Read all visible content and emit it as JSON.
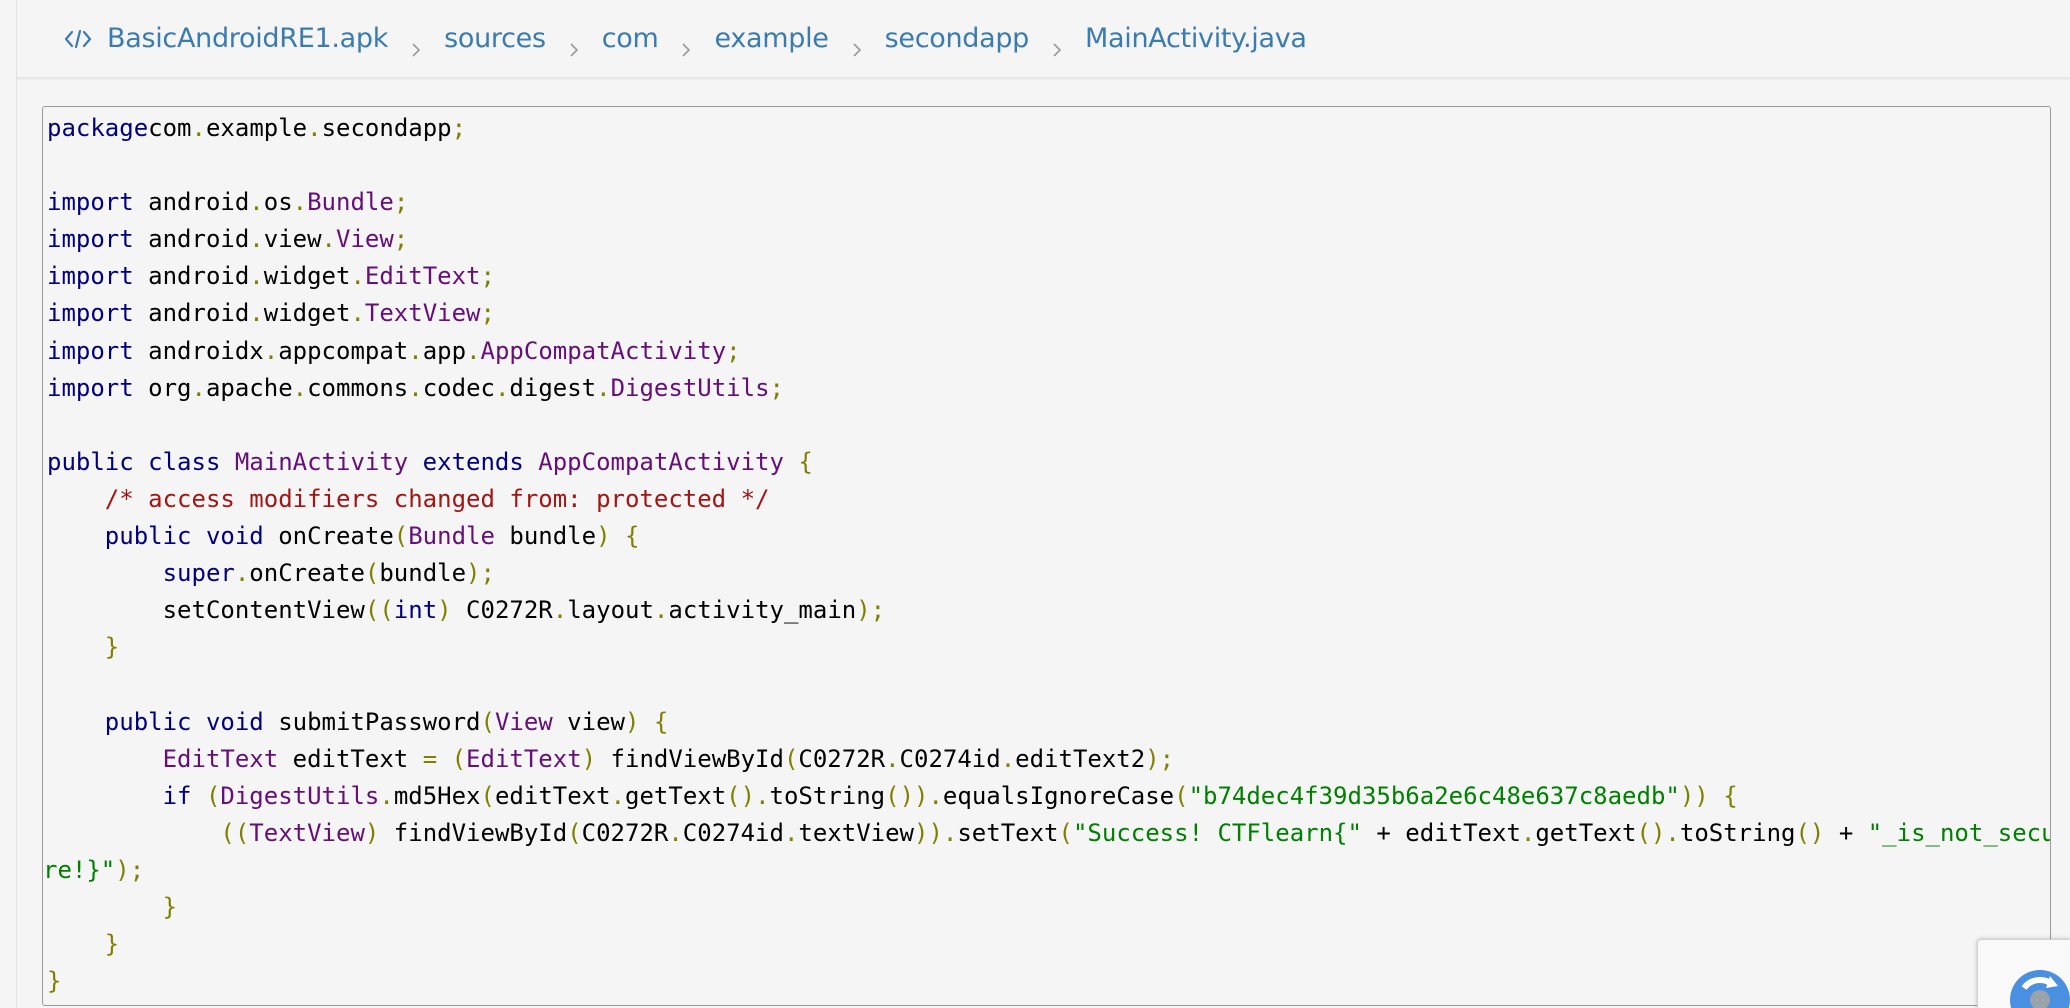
{
  "breadcrumb": {
    "icon": "code-icon",
    "items": [
      "BasicAndroidRE1.apk",
      "sources",
      "com",
      "example",
      "secondapp",
      "MainActivity.java"
    ]
  },
  "code": {
    "lines": [
      [
        [
          "kw",
          "package"
        ],
        [
          "",
          "com"
        ],
        [
          "pu",
          "."
        ],
        [
          "",
          "example"
        ],
        [
          "pu",
          "."
        ],
        [
          "",
          "secondapp"
        ],
        [
          "pu",
          ";"
        ]
      ],
      [],
      [
        [
          "kw",
          "import"
        ],
        [
          "",
          " android"
        ],
        [
          "pu",
          "."
        ],
        [
          "",
          "os"
        ],
        [
          "pu",
          "."
        ],
        [
          "ty",
          "Bundle"
        ],
        [
          "pu",
          ";"
        ]
      ],
      [
        [
          "kw",
          "import"
        ],
        [
          "",
          " android"
        ],
        [
          "pu",
          "."
        ],
        [
          "",
          "view"
        ],
        [
          "pu",
          "."
        ],
        [
          "ty",
          "View"
        ],
        [
          "pu",
          ";"
        ]
      ],
      [
        [
          "kw",
          "import"
        ],
        [
          "",
          " android"
        ],
        [
          "pu",
          "."
        ],
        [
          "",
          "widget"
        ],
        [
          "pu",
          "."
        ],
        [
          "ty",
          "EditText"
        ],
        [
          "pu",
          ";"
        ]
      ],
      [
        [
          "kw",
          "import"
        ],
        [
          "",
          " android"
        ],
        [
          "pu",
          "."
        ],
        [
          "",
          "widget"
        ],
        [
          "pu",
          "."
        ],
        [
          "ty",
          "TextView"
        ],
        [
          "pu",
          ";"
        ]
      ],
      [
        [
          "kw",
          "import"
        ],
        [
          "",
          " androidx"
        ],
        [
          "pu",
          "."
        ],
        [
          "",
          "appcompat"
        ],
        [
          "pu",
          "."
        ],
        [
          "",
          "app"
        ],
        [
          "pu",
          "."
        ],
        [
          "ty",
          "AppCompatActivity"
        ],
        [
          "pu",
          ";"
        ]
      ],
      [
        [
          "kw",
          "import"
        ],
        [
          "",
          " org"
        ],
        [
          "pu",
          "."
        ],
        [
          "",
          "apache"
        ],
        [
          "pu",
          "."
        ],
        [
          "",
          "commons"
        ],
        [
          "pu",
          "."
        ],
        [
          "",
          "codec"
        ],
        [
          "pu",
          "."
        ],
        [
          "",
          "digest"
        ],
        [
          "pu",
          "."
        ],
        [
          "ty",
          "DigestUtils"
        ],
        [
          "pu",
          ";"
        ]
      ],
      [],
      [
        [
          "kw",
          "public class "
        ],
        [
          "ty",
          "MainActivity"
        ],
        [
          "kw",
          " extends "
        ],
        [
          "ty",
          "AppCompatActivity"
        ],
        [
          "pu",
          " {"
        ]
      ],
      [
        [
          "",
          "    "
        ],
        [
          "co",
          "/* access modifiers changed from: protected */"
        ]
      ],
      [
        [
          "kw",
          "    public void "
        ],
        [
          "",
          "onCreate"
        ],
        [
          "pu",
          "("
        ],
        [
          "ty",
          "Bundle"
        ],
        [
          "",
          " bundle"
        ],
        [
          "pu",
          ") {"
        ]
      ],
      [
        [
          "kw",
          "        super"
        ],
        [
          "pu",
          "."
        ],
        [
          "",
          "onCreate"
        ],
        [
          "pu",
          "("
        ],
        [
          "",
          "bundle"
        ],
        [
          "pu",
          ");"
        ]
      ],
      [
        [
          "",
          "        setContentView"
        ],
        [
          "pu",
          "(("
        ],
        [
          "kw",
          "int"
        ],
        [
          "pu",
          ")"
        ],
        [
          "",
          " C0272R"
        ],
        [
          "pu",
          "."
        ],
        [
          "",
          "layout"
        ],
        [
          "pu",
          "."
        ],
        [
          "",
          "activity_main"
        ],
        [
          "pu",
          ");"
        ]
      ],
      [
        [
          "pu",
          "    }"
        ]
      ],
      [],
      [
        [
          "kw",
          "    public void "
        ],
        [
          "",
          "submitPassword"
        ],
        [
          "pu",
          "("
        ],
        [
          "ty",
          "View"
        ],
        [
          "",
          " view"
        ],
        [
          "pu",
          ") {"
        ]
      ],
      [
        [
          "ty",
          "        EditText"
        ],
        [
          "",
          " editText "
        ],
        [
          "pu",
          "= ("
        ],
        [
          "ty",
          "EditText"
        ],
        [
          "pu",
          ")"
        ],
        [
          "",
          " findViewById"
        ],
        [
          "pu",
          "("
        ],
        [
          "",
          "C0272R"
        ],
        [
          "pu",
          "."
        ],
        [
          "",
          "C0274id"
        ],
        [
          "pu",
          "."
        ],
        [
          "",
          "editText2"
        ],
        [
          "pu",
          ");"
        ]
      ],
      [
        [
          "kw",
          "        if "
        ],
        [
          "pu",
          "("
        ],
        [
          "ty",
          "DigestUtils"
        ],
        [
          "pu",
          "."
        ],
        [
          "",
          "md5Hex"
        ],
        [
          "pu",
          "("
        ],
        [
          "",
          "editText"
        ],
        [
          "pu",
          "."
        ],
        [
          "",
          "getText"
        ],
        [
          "pu",
          "()."
        ],
        [
          "",
          "toString"
        ],
        [
          "pu",
          "())."
        ],
        [
          "",
          "equalsIgnoreCase"
        ],
        [
          "pu",
          "("
        ],
        [
          "st",
          "\"b74dec4f39d35b6a2e6c48e637c8aedb\""
        ],
        [
          "pu",
          ")) {"
        ]
      ],
      [
        [
          "pu",
          "            (("
        ],
        [
          "ty",
          "TextView"
        ],
        [
          "pu",
          ")"
        ],
        [
          "",
          " findViewById"
        ],
        [
          "pu",
          "("
        ],
        [
          "",
          "C0272R"
        ],
        [
          "pu",
          "."
        ],
        [
          "",
          "C0274id"
        ],
        [
          "pu",
          "."
        ],
        [
          "",
          "textView"
        ],
        [
          "pu",
          "))."
        ],
        [
          "",
          "setText"
        ],
        [
          "pu",
          "("
        ],
        [
          "st",
          "\"Success! CTFlearn{\""
        ],
        [
          "",
          " + editText"
        ],
        [
          "pu",
          "."
        ],
        [
          "",
          "getText"
        ],
        [
          "pu",
          "()."
        ],
        [
          "",
          "toString"
        ],
        [
          "pu",
          "()"
        ],
        [
          "",
          " + "
        ],
        [
          "st",
          "\"_is_not_secu"
        ]
      ],
      [
        [
          "st",
          "re!}\""
        ],
        [
          "pu",
          ");"
        ]
      ],
      [
        [
          "pu",
          "        }"
        ]
      ],
      [
        [
          "pu",
          "    }"
        ]
      ],
      [
        [
          "pu",
          "}"
        ]
      ]
    ]
  },
  "colors": {
    "keyword": "#000080",
    "type": "#660e7a",
    "punctuation": "#808000",
    "comment": "#a31515",
    "string": "#008000",
    "link": "#3a7cb0"
  },
  "widget": {
    "icon": "recaptcha-icon"
  }
}
